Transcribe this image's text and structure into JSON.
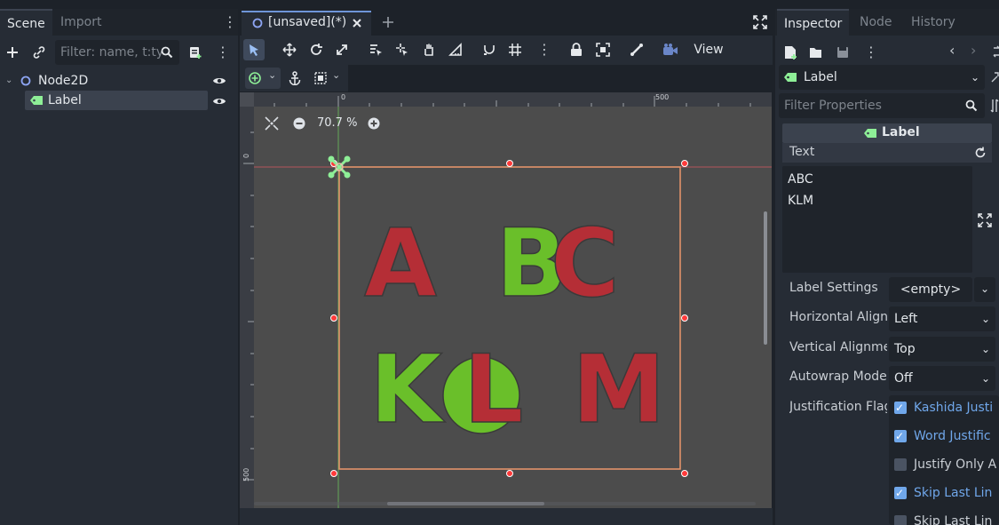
{
  "scene_panel": {
    "tabs": [
      "Scene",
      "Import"
    ],
    "filter_placeholder": "Filter: name, t:ty",
    "tree": [
      {
        "name": "Node2D",
        "type": "node2d"
      },
      {
        "name": "Label",
        "type": "label"
      }
    ]
  },
  "center": {
    "scene_tab_label": "[unsaved](*)",
    "view_menu": "View",
    "zoom": "70.7 %",
    "ruler": {
      "top_0": "0",
      "top_500": "500",
      "left_0": "0",
      "left_500": "500"
    }
  },
  "canvas_letters": [
    {
      "char": "A",
      "color": "#b52e36"
    },
    {
      "char": "B",
      "color": "#6abf2a"
    },
    {
      "char": "C",
      "color": "#b52e36"
    },
    {
      "char": "K",
      "color": "#6abf2a"
    },
    {
      "char": "L",
      "color": "#b52e36"
    },
    {
      "char": "M",
      "color": "#b52e36"
    }
  ],
  "inspector": {
    "tabs": [
      "Inspector",
      "Node",
      "History"
    ],
    "node_selector": "Label",
    "filter_placeholder": "Filter Properties",
    "section_header": "Label",
    "text_property_label": "Text",
    "text_value_lines": [
      "ABC",
      "KLM"
    ],
    "properties": [
      {
        "label": "Label Settings",
        "value": "<empty>"
      },
      {
        "label": "Horizontal Align",
        "value": "Left"
      },
      {
        "label": "Vertical Alignme",
        "value": "Top"
      },
      {
        "label": "Autowrap Mode",
        "value": "Off"
      }
    ],
    "justification_label": "Justification Flag",
    "justification_flags": [
      {
        "label": "Kashida Justi",
        "checked": true
      },
      {
        "label": "Word Justific",
        "checked": true
      },
      {
        "label": "Justify Only A",
        "checked": false
      },
      {
        "label": "Skip Last Lin",
        "checked": true
      },
      {
        "label": "Skip Last Lin",
        "checked": false
      }
    ]
  },
  "colors": {
    "accent": "#70a7ea",
    "label_green": "#8eef97",
    "selection_orange": "#e3936a",
    "handle_red": "#ff3a3a"
  }
}
